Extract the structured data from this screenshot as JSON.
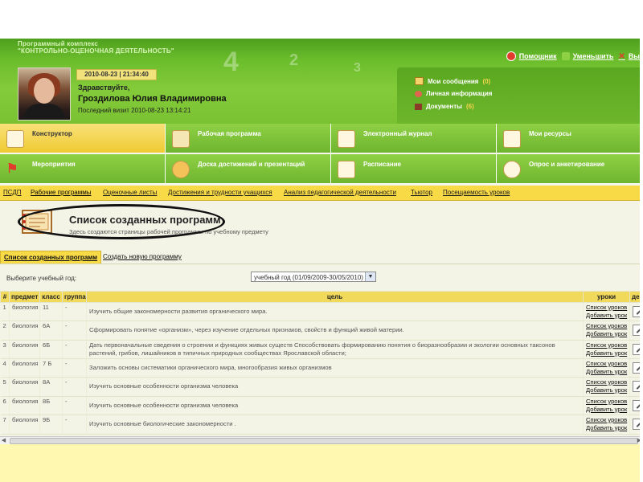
{
  "header": {
    "title_line1": "Программный комплекс",
    "title_line2": "\"КОНТРОЛЬНО-ОЦЕНОЧНАЯ ДЕЯТЕЛЬНОСТЬ\"",
    "links": [
      "Помощник",
      "Уменьшить",
      "Вы"
    ]
  },
  "user": {
    "datetime": "2010-08-23 | 21:34:40",
    "greeting": "Здравствуйте,",
    "name": "Гроздилова Юлия Владимировна",
    "last_visit": "Последний визит 2010-08-23 13:14:21"
  },
  "messages": [
    {
      "label": "Мои сообщения",
      "count": "(0)"
    },
    {
      "label": "Личная информация",
      "count": ""
    },
    {
      "label": "Документы",
      "count": "(6)"
    }
  ],
  "nav": {
    "row1": [
      "Конструктор",
      "Рабочая программа",
      "Электронный журнал",
      "Мои ресурсы"
    ],
    "row2": [
      "Мероприятия",
      "Доска достижений и презентаций",
      "Расписание",
      "Опрос и анкетирование"
    ]
  },
  "subtabs": [
    "ПСДП",
    "Рабочие программы",
    "Оценочные листы",
    "Достижения и трудности учащихся",
    "Анализ педагогической деятельности",
    "Тьютор",
    "Посещаемость уроков"
  ],
  "page": {
    "title": "Список созданных программ",
    "subtitle": "Здесь создаются страницы рабочей программы по учебному предмету"
  },
  "content_tabs": [
    "Список созданных программ",
    "Создать новую программу"
  ],
  "filter": {
    "label": "Выберите учебный год:",
    "selected": "учебный год (01/09/2009-30/05/2010)"
  },
  "table": {
    "headers": [
      "#",
      "предмет",
      "класс",
      "группа",
      "цель",
      "уроки",
      "дей"
    ],
    "link_list": "Список уроков",
    "link_add": "Добавить урок",
    "rows": [
      {
        "n": "1",
        "subject": "биология",
        "class": "11",
        "group": "-",
        "goal": "Изучить общие закономерности развития органического мира."
      },
      {
        "n": "2",
        "subject": "биология",
        "class": "6А",
        "group": "-",
        "goal": "Сформировать понятие «организм», через изучение отдельных признаков, свойств и функций живой материи."
      },
      {
        "n": "3",
        "subject": "биология",
        "class": "6Б",
        "group": "-",
        "goal": "Дать первоначальные сведения о строении и функциях живых существ Способствовать формированию понятия о биоразнообразии и экологии основных таксонов растений, грибов, лишайников в типичных природных сообществах Ярославской области;"
      },
      {
        "n": "4",
        "subject": "биология",
        "class": "7 Б",
        "group": "-",
        "goal": "Заложить основы систематики органического мира, многообразия живых организмов"
      },
      {
        "n": "5",
        "subject": "биология",
        "class": "8А",
        "group": "-",
        "goal": "Изучить основные особенности организма человека"
      },
      {
        "n": "6",
        "subject": "биология",
        "class": "8Б",
        "group": "-",
        "goal": "Изучить основные особенности организма человека"
      },
      {
        "n": "7",
        "subject": "биология",
        "class": "9Б",
        "group": "-",
        "goal": "Изучить основные биологические закономерности ."
      }
    ]
  },
  "colors": {
    "header_green": "#6bbd2c",
    "nav_active_yellow": "#efca32",
    "tab_yellow": "#f8da47",
    "content_bg": "#f3f3e6"
  }
}
